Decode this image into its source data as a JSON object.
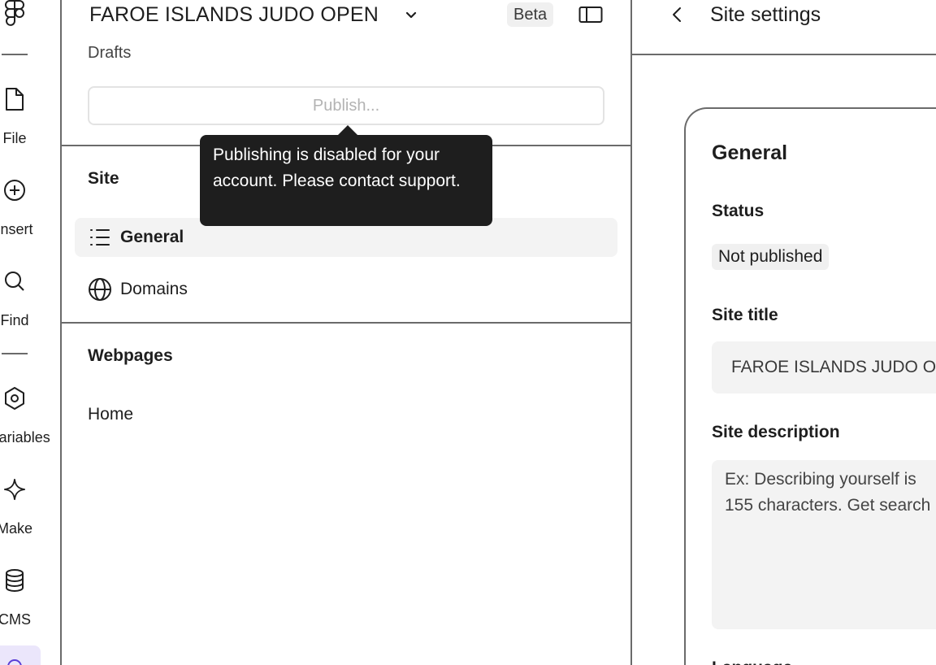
{
  "rail": {
    "items": [
      {
        "label": "File",
        "icon": "file-icon"
      },
      {
        "label": "Insert",
        "icon": "plus-circle-icon"
      },
      {
        "label": "Find",
        "icon": "search-icon"
      },
      {
        "label": "Variables",
        "icon": "variables-icon"
      },
      {
        "label": "Make",
        "icon": "sparkle-icon"
      },
      {
        "label": "CMS",
        "icon": "database-icon"
      }
    ]
  },
  "panel": {
    "site_name": "FAROE ISLANDS JUDO OPEN",
    "beta": "Beta",
    "drafts": "Drafts",
    "publish_label": "Publish...",
    "site_section": "Site",
    "nav": [
      {
        "label": "General",
        "icon": "list-icon",
        "active": true
      },
      {
        "label": "Domains",
        "icon": "globe-icon",
        "active": false
      }
    ],
    "webpages_section": "Webpages",
    "webpages": [
      "Home"
    ]
  },
  "tooltip": {
    "text": "Publishing is disabled for your account. Please contact support."
  },
  "settings": {
    "title": "Site settings",
    "card_title": "General",
    "status_label": "Status",
    "status_value": "Not published",
    "site_title_label": "Site title",
    "site_title_value": "FAROE ISLANDS JUDO OPEN",
    "description_label": "Site description",
    "description_placeholder": "Ex: Describing yourself is\n155 characters. Get search",
    "next_label": "Language"
  },
  "colors": {
    "tooltip_bg": "#1e1e1e",
    "active_nav_bg": "#f3f3f3",
    "rail_active_bg": "#ebe6fb"
  }
}
